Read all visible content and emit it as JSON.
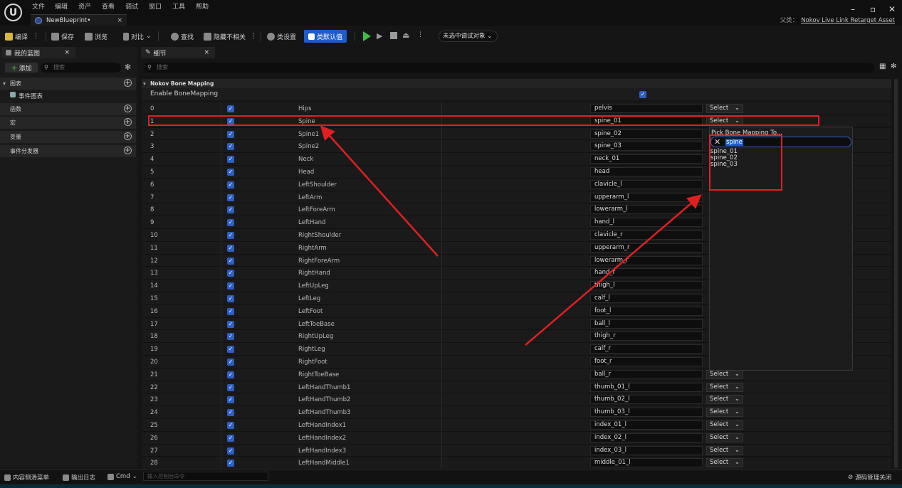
{
  "menu": [
    "文件",
    "编辑",
    "资产",
    "查看",
    "调试",
    "窗口",
    "工具",
    "帮助"
  ],
  "tab_title": "NewBlueprint•",
  "parent_label": "父类：",
  "parent_class": "Nokov Live Link Retarget Asset",
  "toolbar": {
    "compile": "编译",
    "save": "保存",
    "browse": "浏览",
    "diff": "对比",
    "find": "查找",
    "hide_unrelated": "隐藏不相关",
    "class_settings": "类设置",
    "class_defaults": "类默认值",
    "debug_object": "未选中调试对象"
  },
  "left_panel": {
    "tab": "我的蓝图",
    "add": "添加",
    "search_placeholder": "搜索",
    "sections": [
      "图表",
      "函数",
      "宏",
      "变量",
      "事件分发器"
    ],
    "event_graph": "事件图表"
  },
  "details": {
    "tab": "细节",
    "search_placeholder": "搜索",
    "category": "Nokov Bone Mapping",
    "enable_label": "Enable BoneMapping",
    "select_label": "Select"
  },
  "rows": [
    {
      "index": "0",
      "name": "Hips",
      "value": "pelvis"
    },
    {
      "index": "1",
      "name": "Spine",
      "value": "spine_01"
    },
    {
      "index": "2",
      "name": "Spine1",
      "value": "spine_02"
    },
    {
      "index": "3",
      "name": "Spine2",
      "value": "spine_03"
    },
    {
      "index": "4",
      "name": "Neck",
      "value": "neck_01"
    },
    {
      "index": "5",
      "name": "Head",
      "value": "head"
    },
    {
      "index": "6",
      "name": "LeftShoulder",
      "value": "clavicle_l"
    },
    {
      "index": "7",
      "name": "LeftArm",
      "value": "upperarm_l"
    },
    {
      "index": "8",
      "name": "LeftForeArm",
      "value": "lowerarm_l"
    },
    {
      "index": "9",
      "name": "LeftHand",
      "value": "hand_l"
    },
    {
      "index": "10",
      "name": "RightShoulder",
      "value": "clavicle_r"
    },
    {
      "index": "11",
      "name": "RightArm",
      "value": "upperarm_r"
    },
    {
      "index": "12",
      "name": "RightForeArm",
      "value": "lowerarm_r"
    },
    {
      "index": "13",
      "name": "RightHand",
      "value": "hand_r"
    },
    {
      "index": "14",
      "name": "LeftUpLeg",
      "value": "thigh_l"
    },
    {
      "index": "15",
      "name": "LeftLeg",
      "value": "calf_l"
    },
    {
      "index": "16",
      "name": "LeftFoot",
      "value": "foot_l"
    },
    {
      "index": "17",
      "name": "LeftToeBase",
      "value": "ball_l"
    },
    {
      "index": "18",
      "name": "RightUpLeg",
      "value": "thigh_r"
    },
    {
      "index": "19",
      "name": "RightLeg",
      "value": "calf_r"
    },
    {
      "index": "20",
      "name": "RightFoot",
      "value": "foot_r"
    },
    {
      "index": "21",
      "name": "RightToeBase",
      "value": "ball_r"
    },
    {
      "index": "22",
      "name": "LeftHandThumb1",
      "value": "thumb_01_l"
    },
    {
      "index": "23",
      "name": "LeftHandThumb2",
      "value": "thumb_02_l"
    },
    {
      "index": "24",
      "name": "LeftHandThumb3",
      "value": "thumb_03_l"
    },
    {
      "index": "25",
      "name": "LeftHandIndex1",
      "value": "index_01_l"
    },
    {
      "index": "26",
      "name": "LeftHandIndex2",
      "value": "index_02_l"
    },
    {
      "index": "27",
      "name": "LeftHandIndex3",
      "value": "index_03_l"
    },
    {
      "index": "28",
      "name": "LeftHandMiddle1",
      "value": "middle_01_l"
    }
  ],
  "popup": {
    "title": "Pick Bone Mapping To...",
    "search_text": "spine",
    "options": [
      "spine_01",
      "spine_02",
      "spine_03"
    ]
  },
  "statusbar": {
    "content_drawer": "内容侧滑菜单",
    "output_log": "输出日志",
    "cmd": "Cmd",
    "console_placeholder": "输入控制台命令",
    "source_control": "源码管理关闭"
  },
  "colors": {
    "accent": "#1e5ccc",
    "annotation_red": "#e02020"
  }
}
